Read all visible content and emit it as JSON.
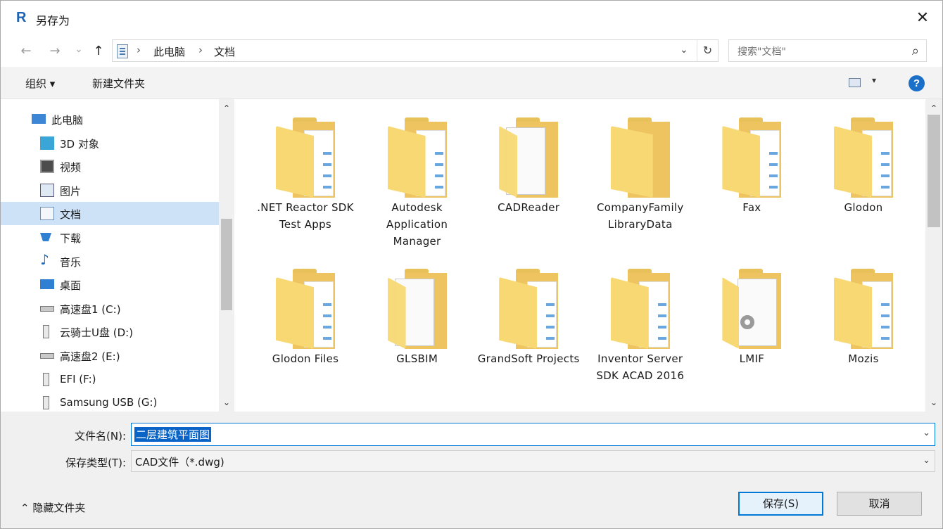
{
  "window": {
    "title": "另存为",
    "close_label": "✕"
  },
  "address": {
    "back_label": "←",
    "forward_label": "→",
    "recent_label": "⌄",
    "up_label": "↑",
    "breadcrumb": [
      "此电脑",
      "文档"
    ],
    "sep": "›",
    "dropdown_label": "⌄",
    "refresh_label": "↻",
    "search_placeholder": "搜索\"文档\""
  },
  "toolbar": {
    "organize_label": "组织 ▾",
    "new_folder_label": "新建文件夹",
    "view_dd": "▾",
    "help_label": "?"
  },
  "nav": {
    "items": [
      {
        "label": "此电脑",
        "icon": "computer-icon"
      },
      {
        "label": "3D 对象",
        "icon": "3d-objects-icon"
      },
      {
        "label": "视频",
        "icon": "video-icon"
      },
      {
        "label": "图片",
        "icon": "pictures-icon"
      },
      {
        "label": "文档",
        "icon": "documents-icon",
        "selected": true
      },
      {
        "label": "下载",
        "icon": "download-icon"
      },
      {
        "label": "音乐",
        "icon": "music-icon"
      },
      {
        "label": "桌面",
        "icon": "desktop-icon"
      },
      {
        "label": "高速盘1 (C:)",
        "icon": "drive-icon"
      },
      {
        "label": "云骑士U盘 (D:)",
        "icon": "usb-drive-icon"
      },
      {
        "label": "高速盘2 (E:)",
        "icon": "drive-icon"
      },
      {
        "label": "EFI (F:)",
        "icon": "usb-drive-icon"
      },
      {
        "label": "Samsung USB (G:)",
        "icon": "usb-drive-icon"
      }
    ]
  },
  "files": [
    {
      "name": ".NET Reactor SDK Test Apps",
      "kind": "folder-with-docs"
    },
    {
      "name": "Autodesk Application Manager",
      "kind": "folder-with-docs"
    },
    {
      "name": "CADReader",
      "kind": "folder-with-paper"
    },
    {
      "name": "CompanyFamily LibraryData",
      "kind": "folder-empty"
    },
    {
      "name": "Fax",
      "kind": "folder-with-docs"
    },
    {
      "name": "Glodon",
      "kind": "folder-with-docs"
    },
    {
      "name": "Glodon Files",
      "kind": "folder-with-docs"
    },
    {
      "name": "GLSBIM",
      "kind": "folder-with-paper"
    },
    {
      "name": "GrandSoft Projects",
      "kind": "folder-with-docs"
    },
    {
      "name": "Inventor Server SDK ACAD 2016",
      "kind": "folder-with-docs"
    },
    {
      "name": "LMIF",
      "kind": "folder-with-gear"
    },
    {
      "name": "Mozis",
      "kind": "folder-with-docs"
    }
  ],
  "bottom": {
    "filename_label": "文件名(N):",
    "filename_value": "二层建筑平面图",
    "filetype_label": "保存类型(T):",
    "filetype_value": "CAD文件（*.dwg)",
    "hide_folders_label": "⌃ 隐藏文件夹",
    "save_label": "保存(S)",
    "cancel_label": "取消"
  }
}
